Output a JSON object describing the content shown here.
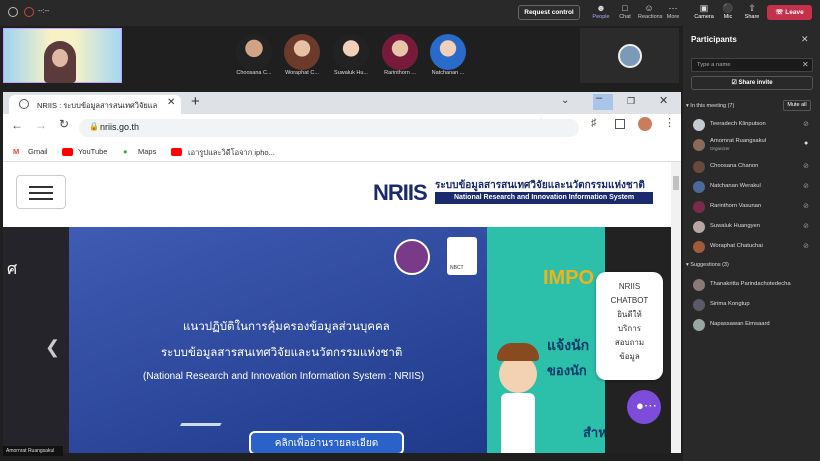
{
  "teams": {
    "meeting_time": "--:--",
    "request_control": "Request control",
    "actions": [
      "People",
      "Chat",
      "Reactions",
      "More"
    ],
    "device_actions": [
      "Camera",
      "Mic",
      "Share"
    ],
    "leave": "Leave",
    "self_name": "Amornrat Ruangsakul",
    "video_names": [
      "Choosana C...",
      "Woraphat C...",
      "Suwaluk Hu...",
      "Rarinthorn ...",
      "Natchanan ..."
    ]
  },
  "browser": {
    "tab_title": "NRIIS : ระบบข้อมูลสารสนเทศวิจัยและนวั",
    "url": "nriis.go.th",
    "bookmarks": [
      "Gmail",
      "YouTube",
      "Maps",
      "เอารูปและวิดีโอจาก ipho..."
    ]
  },
  "page": {
    "logo": "NRIIS",
    "thai_title": "ระบบข้อมูลสารสนเทศวิจัยและนวัตกรรมแห่งชาติ",
    "en_title": "National Research and Innovation Information System",
    "hero_partial": "ศ",
    "hero_line1": "แนวปฏิบัติในการคุ้มครองข้อมูลส่วนบุคคล",
    "hero_line2": "ระบบข้อมูลสารสนเทศวิจัยและนวัตกรรมแห่งชาติ",
    "hero_line3": "(National Research and Innovation Information System : NRIIS)",
    "hero_button": "คลิกเพื่ออ่านรายละเอียด",
    "right_heading": "IMPO",
    "right_sub": "แจ้งนัก",
    "right_sub2": "ของนัก",
    "right_sub3": "สำห",
    "nbct_badge": "NBCT",
    "chatbot": [
      "NRIIS",
      "CHATBOT",
      "ยินดีให้",
      "บริการ",
      "สอบถาม",
      "ข้อมูล"
    ]
  },
  "participants": {
    "title": "Participants",
    "search_placeholder": "Type a name",
    "share_invite": "Share invite",
    "in_meeting": "In this meeting (7)",
    "mute_all": "Mute all",
    "members": [
      {
        "name": "Teeradech Klinputson",
        "role": ""
      },
      {
        "name": "Amornrat Ruangsakul",
        "role": "Organizer"
      },
      {
        "name": "Choosana Chanon",
        "role": ""
      },
      {
        "name": "Natchanan Werakul",
        "role": ""
      },
      {
        "name": "Rarinthorn Vasunan",
        "role": ""
      },
      {
        "name": "Suwaluk Huangyen",
        "role": ""
      },
      {
        "name": "Woraphat Chatuchai",
        "role": ""
      }
    ],
    "suggestions": "Suggestions (3)",
    "suggested": [
      "Thanakritta Parindachotedecha",
      "Sirima Kongtup",
      "Napassawan Eimsaard"
    ]
  },
  "colors": {
    "leave": "#c4314b",
    "hero": "#2a479a",
    "teal": "#2cbfa9",
    "chat": "#7d4cdb"
  }
}
